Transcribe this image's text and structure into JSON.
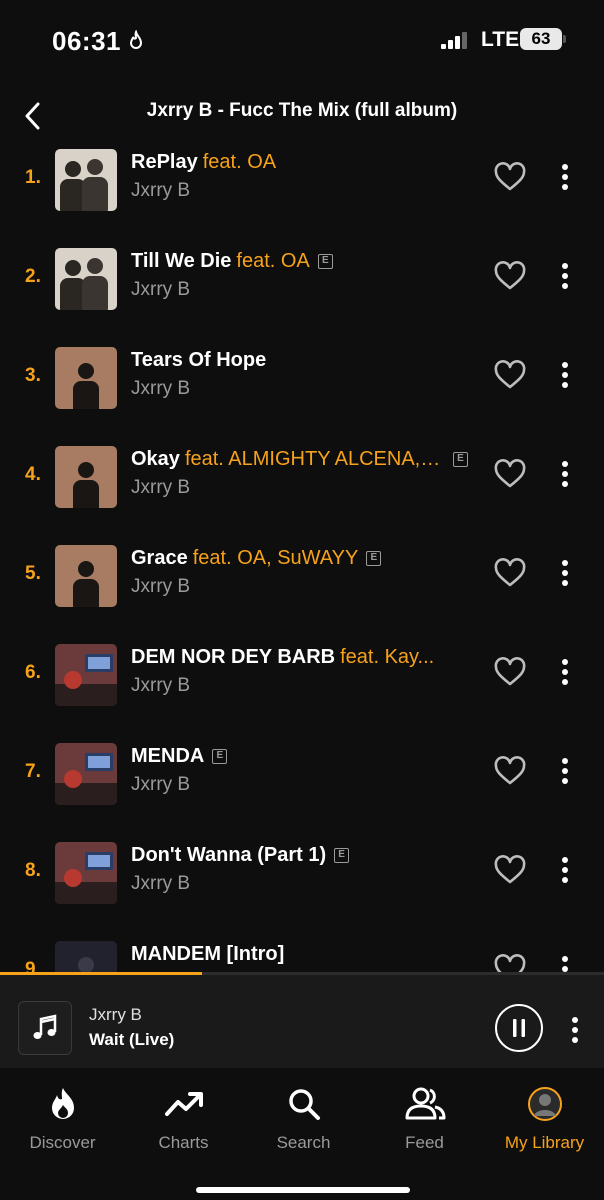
{
  "status": {
    "time": "06:31",
    "network": "LTE",
    "battery": "63"
  },
  "header": {
    "title": "Jxrry B - Fucc The Mix (full album)"
  },
  "tracks": [
    {
      "num": "1.",
      "title": "RePlay",
      "feat": "feat. OA",
      "artist": "Jxrry  B",
      "explicit": false
    },
    {
      "num": "2.",
      "title": "Till We Die",
      "feat": "feat. OA",
      "artist": "Jxrry  B",
      "explicit": true
    },
    {
      "num": "3.",
      "title": "Tears Of Hope",
      "feat": "",
      "artist": "Jxrry B",
      "explicit": false
    },
    {
      "num": "4.",
      "title": "Okay",
      "feat": "feat. ALMIGHTY ALCENA, S...",
      "artist": "Jxrry B",
      "explicit": true
    },
    {
      "num": "5.",
      "title": "Grace",
      "feat": "feat. OA, SuWAYY",
      "artist": "Jxrry  B",
      "explicit": true
    },
    {
      "num": "6.",
      "title": "DEM NOR DEY BARB",
      "feat": "feat. Kay...",
      "artist": "Jxrry  B",
      "explicit": false
    },
    {
      "num": "7.",
      "title": "MENDA",
      "feat": "",
      "artist": "Jxrry  B",
      "explicit": true
    },
    {
      "num": "8.",
      "title": "Don't Wanna (Part 1)",
      "feat": "",
      "artist": "Jxrry  B",
      "explicit": true
    },
    {
      "num": "9.",
      "title": "MANDEM [Intro]",
      "feat": "",
      "artist": "",
      "explicit": false
    }
  ],
  "explicit_label": "E",
  "player": {
    "artist": "Jxrry B",
    "title": "Wait (Live)",
    "progress": 0.335
  },
  "tabs": [
    {
      "label": "Discover",
      "icon": "flame-icon"
    },
    {
      "label": "Charts",
      "icon": "trend-icon"
    },
    {
      "label": "Search",
      "icon": "search-icon"
    },
    {
      "label": "Feed",
      "icon": "people-icon"
    },
    {
      "label": "My Library",
      "icon": "avatar-icon",
      "active": true
    }
  ],
  "colors": {
    "accent": "#f7a21b",
    "background": "#0e0e0e",
    "muted": "#9a9a9a"
  }
}
